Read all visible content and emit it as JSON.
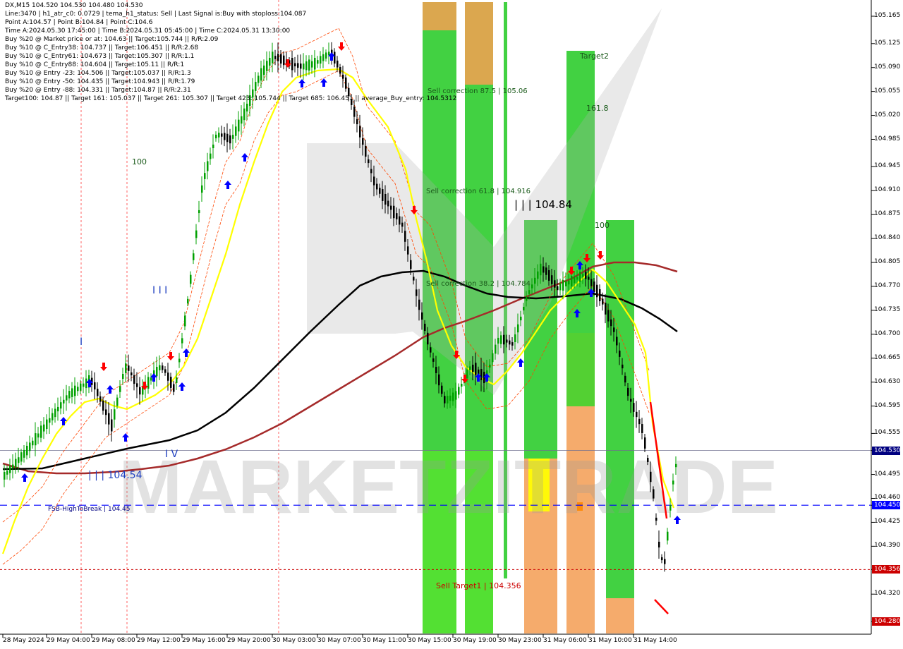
{
  "header_lines": [
    "DX,M15  104.520 104.530 104.480 104.530",
    "Line:3470 | h1_atr_c0: 0.0729 | tema_h1_status: Sell | Last Signal is:Buy with stoploss:104.087",
    "Point A:104.57 | Point B:104.84 | Point C:104.6",
    "Time A:2024.05.30 17:45:00 | Time B:2024.05.31 05:45:00 | Time C:2024.05.31 13:30:00",
    "Buy %20 @ Market price or at: 104.63 || Target:105.744 || R/R:2.09",
    "Buy %10 @ C_Entry38: 104.737 || Target:106.451 || R/R:2.68",
    "Buy %10 @ C_Entry61: 104.673 || Target:105.307 || R/R:1.1",
    "Buy %10 @ C_Entry88: 104.604 || Target:105.11 || R/R:1",
    "Buy %10 @ Entry -23: 104.506 || Target:105.037 || R/R:1.3",
    "Buy %10 @ Entry -50: 104.435 || Target:104.943 || R/R:1.79",
    "Buy %20 @ Entry -88: 104.331 || Target:104.87 || R/R:2.31",
    "Target100: 104.87 || Target 161: 105.037 || Target 261: 105.307 || Target 423: 105.744 || Target 685: 106.451 || average_Buy_entry: 104.5312"
  ],
  "price_axis": [
    "105.165",
    "105.125",
    "105.090",
    "105.055",
    "105.020",
    "104.985",
    "104.945",
    "104.910",
    "104.875",
    "104.840",
    "104.805",
    "104.770",
    "104.735",
    "104.700",
    "104.665",
    "104.630",
    "104.595",
    "104.555",
    "104.530",
    "104.495",
    "104.460",
    "104.450",
    "104.425",
    "104.390",
    "104.356",
    "104.320",
    "104.280"
  ],
  "current_price": "104.530",
  "fsb_price": "104.450",
  "target_price": "104.356",
  "bottom_price": "104.280",
  "time_axis": [
    "28 May 2024",
    "29 May 04:00",
    "29 May 08:00",
    "29 May 12:00",
    "29 May 16:00",
    "29 May 20:00",
    "30 May 03:00",
    "30 May 07:00",
    "30 May 11:00",
    "30 May 15:00",
    "30 May 19:00",
    "30 May 23:00",
    "31 May 06:00",
    "31 May 10:00",
    "31 May 14:00"
  ],
  "annotations": {
    "sell_corr_875": "Sell correction 87.5 | 105.06",
    "sell_corr_618": "Sell correction 61.8 | 104.916",
    "sell_corr_382": "Sell correction 38.2 | 104.784",
    "sell_target1": "Sell Target1 | 104.356",
    "fsb": "FSB-HighToBreak | 104.45",
    "level_10484": "| | | 104.84",
    "level_10454": "| | | 104.54",
    "target2": "Target2",
    "fib_1618": "161.8",
    "fib_100": "100",
    "fib_100_right": "100",
    "wave_3": "I I I",
    "wave_4": "I V",
    "wave_1": "I",
    "watermark": "MARKETZITRADE"
  },
  "colors": {
    "bullish_candle": "#00a000",
    "bearish_candle": "#000000",
    "tema_line": "#ffff00",
    "ma_black": "#000000",
    "ma_dark_red": "#a52a2a",
    "green_zone": "#32cd32",
    "orange_zone": "#f4a460",
    "fsb_line": "#0000ff",
    "target_line": "#cc0000",
    "envelope": "#ff4500"
  },
  "chart_data": {
    "type": "candlestick",
    "symbol": "DX",
    "timeframe": "M15",
    "ylim": [
      104.28,
      105.18
    ],
    "x": [
      "28 May 2024",
      "29 May 04:00",
      "29 May 08:00",
      "29 May 12:00",
      "29 May 16:00",
      "29 May 20:00",
      "30 May 03:00",
      "30 May 07:00",
      "30 May 11:00",
      "30 May 15:00",
      "30 May 19:00",
      "30 May 23:00",
      "31 May 06:00",
      "31 May 10:00",
      "31 May 14:00"
    ],
    "close": [
      104.52,
      104.62,
      104.6,
      104.64,
      104.86,
      105.02,
      105.1,
      105.07,
      104.85,
      104.66,
      104.63,
      104.72,
      104.8,
      104.72,
      104.53
    ],
    "high": [
      104.56,
      104.68,
      104.67,
      104.73,
      104.96,
      105.08,
      105.14,
      105.12,
      104.98,
      104.8,
      104.69,
      104.86,
      104.82,
      104.8,
      104.6
    ],
    "low": [
      104.48,
      104.52,
      104.54,
      104.56,
      104.64,
      104.86,
      105.0,
      104.98,
      104.8,
      104.6,
      104.58,
      104.64,
      104.74,
      104.54,
      104.33
    ],
    "current_price": 104.53,
    "levels": {
      "fsb_high_to_break": 104.45,
      "sell_target1": 104.356,
      "sell_correction_38_2": 104.784,
      "sell_correction_61_8": 104.916,
      "sell_correction_87_5": 105.06,
      "level_104_84": 104.84,
      "level_104_54": 104.54
    }
  }
}
